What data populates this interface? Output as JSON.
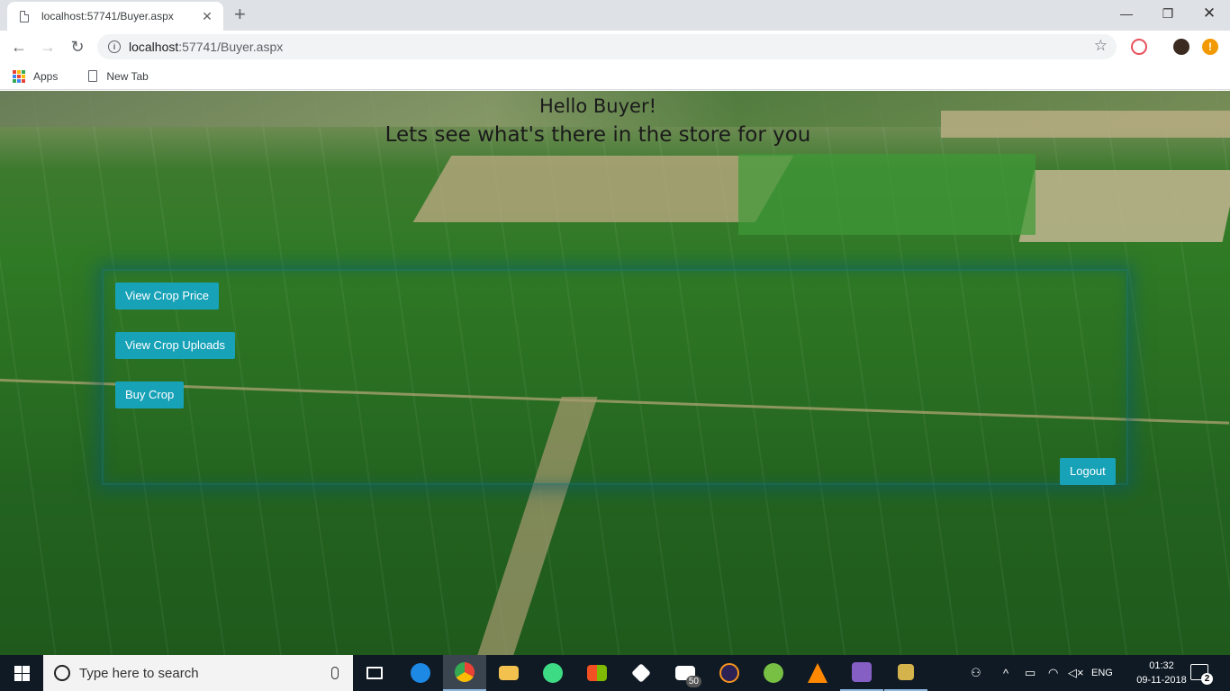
{
  "browser": {
    "tab_title": "localhost:57741/Buyer.aspx",
    "url_host": "localhost",
    "url_rest": ":57741/Buyer.aspx",
    "bookmarks": [
      {
        "label": "Apps",
        "icon": "apps-grid-icon"
      },
      {
        "label": "New Tab",
        "icon": "page-icon"
      }
    ],
    "profile_badge": "!"
  },
  "page": {
    "greeting": "Hello Buyer!",
    "subtitle": "Lets see what's there in the store for you",
    "buttons": {
      "view_crop_price": "View Crop Price",
      "view_crop_uploads": "View Crop Uploads",
      "buy_crop": "Buy Crop",
      "logout": "Logout"
    },
    "accent_color": "#17a2b8",
    "background": "aerial green farm fields image"
  },
  "taskbar": {
    "search_placeholder": "Type here to search",
    "mail_badge": "50",
    "language": "ENG",
    "time": "01:32",
    "date": "09-11-2018",
    "notification_count": "2"
  }
}
